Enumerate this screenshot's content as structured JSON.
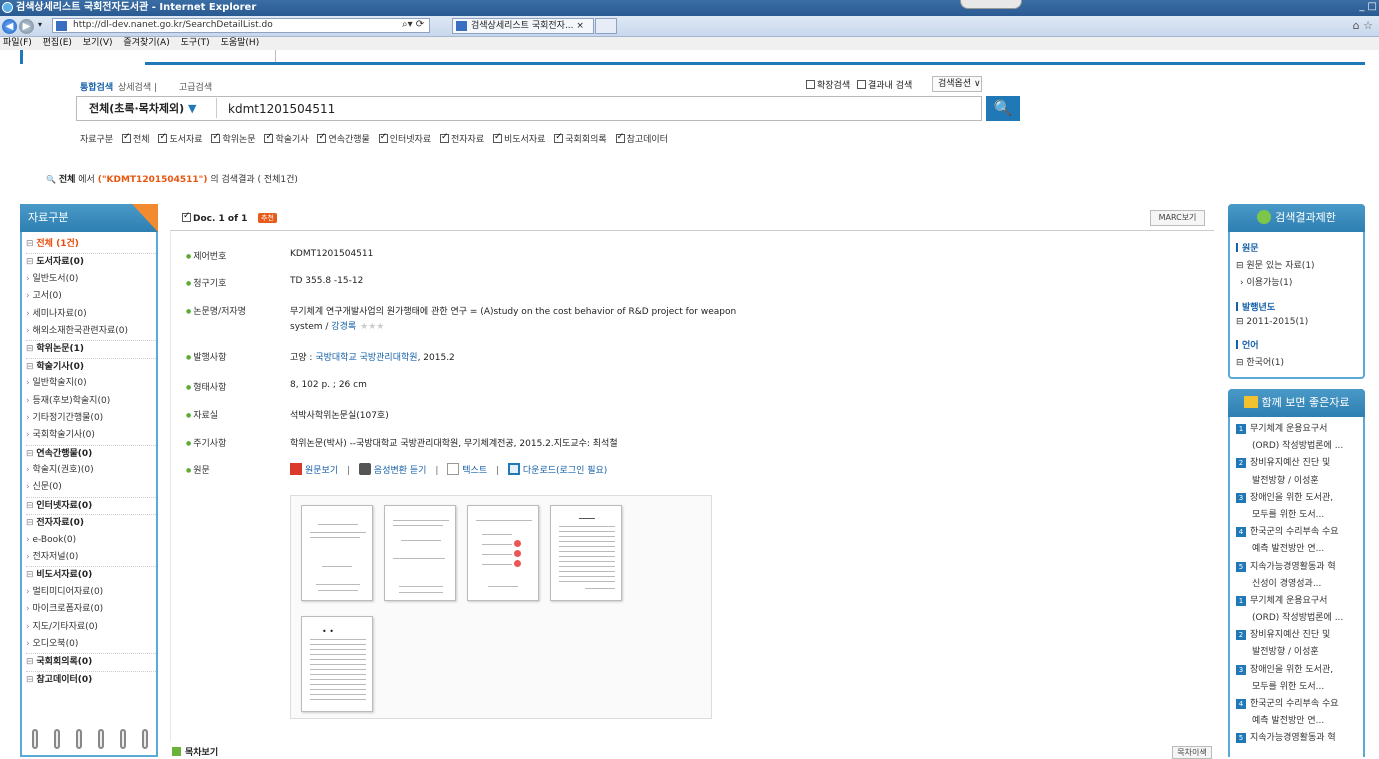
{
  "browser": {
    "title": "검색상세리스트 국회전자도서관 - Internet Explorer",
    "url": "http://dl-dev.nanet.go.kr/SearchDetailList.do",
    "tab_label": "검색상세리스트 국회전자... ×",
    "menu": [
      "파일(F)",
      "편집(E)",
      "보기(V)",
      "즐겨찾기(A)",
      "도구(T)",
      "도움말(H)"
    ],
    "window_controls": "_ □",
    "home_star": "⌂ ☆"
  },
  "search": {
    "tabs": [
      "통합검색",
      "상세검색 |",
      "고급검색"
    ],
    "scope": "전체(초록·목차제외)",
    "scope_arrow": "▼",
    "query": "kdmt1201504511",
    "button_icon": "search-icon",
    "button_glyph": "🔍",
    "options": [
      "확장검색",
      "결과내 검색"
    ],
    "options_select": "검색옵션 ∨",
    "type_label": "자료구분",
    "types": [
      "전체",
      "도서자료",
      "학위논문",
      "학술기사",
      "연속간행물",
      "인터넷자료",
      "전자자료",
      "비도서자료",
      "국회회의록",
      "참고데이터"
    ]
  },
  "result_summary": {
    "icon": "🔍",
    "scope": "전체",
    "in": "에서",
    "query": "(\"KDMT1201504511\")",
    "suffix": "의 검색결과 ( 전체1건)"
  },
  "left_panel": {
    "title": "자료구분",
    "items": [
      {
        "label": "전체 (1건)",
        "kind": "cat red"
      },
      {
        "label": "도서자료(0)",
        "kind": "cat"
      },
      {
        "label": "일반도서(0)",
        "kind": "sub"
      },
      {
        "label": "고서(0)",
        "kind": "sub"
      },
      {
        "label": "세미나자료(0)",
        "kind": "sub"
      },
      {
        "label": "해외소재한국관련자료(0)",
        "kind": "sub"
      },
      {
        "label": "학위논문(1)",
        "kind": "cat"
      },
      {
        "label": "학술기사(0)",
        "kind": "cat"
      },
      {
        "label": "일반학술지(0)",
        "kind": "sub"
      },
      {
        "label": "등재(후보)학술지(0)",
        "kind": "sub"
      },
      {
        "label": "기타정기간행물(0)",
        "kind": "sub"
      },
      {
        "label": "국회학술기사(0)",
        "kind": "sub"
      },
      {
        "label": "연속간행물(0)",
        "kind": "cat"
      },
      {
        "label": "학술지(권호)(0)",
        "kind": "sub"
      },
      {
        "label": "신문(0)",
        "kind": "sub"
      },
      {
        "label": "인터넷자료(0)",
        "kind": "cat"
      },
      {
        "label": "전자자료(0)",
        "kind": "cat"
      },
      {
        "label": "e-Book(0)",
        "kind": "sub"
      },
      {
        "label": "전자저널(0)",
        "kind": "sub"
      },
      {
        "label": "비도서자료(0)",
        "kind": "cat"
      },
      {
        "label": "멀티미디어자료(0)",
        "kind": "sub"
      },
      {
        "label": "마이크로폼자료(0)",
        "kind": "sub"
      },
      {
        "label": "지도/기타자료(0)",
        "kind": "sub"
      },
      {
        "label": "오디오북(0)",
        "kind": "sub"
      },
      {
        "label": "국회회의록(0)",
        "kind": "cat"
      },
      {
        "label": "참고데이터(0)",
        "kind": "cat"
      }
    ]
  },
  "doc": {
    "header": "Doc. 1 of 1",
    "badge": "추천",
    "marc_button": "MARC보기",
    "fields": [
      {
        "label": "제어번호",
        "value": "KDMT1201504511"
      },
      {
        "label": "청구기호",
        "value": "TD 355.8 -15-12"
      },
      {
        "label": "논문명/저자명",
        "value": "무기체계 연구개발사업의 원가행태에 관한 연구 = (A)study on the cost behavior of R&D project for weapon",
        "value2": "system / ",
        "author": "강경록"
      },
      {
        "label": "발행사항",
        "value": "고양 : ",
        "link": "국방대학교 국방관리대학원",
        "value_end": ", 2015.2"
      },
      {
        "label": "형태사항",
        "value": "8, 102 p. ; 26 cm"
      },
      {
        "label": "자료실",
        "value": "석박사학위논문실(107호)"
      },
      {
        "label": "주기사항",
        "value": "학위논문(박사) --국방대학교 국방관리대학원, 무기체계전공, 2015.2.지도교수: 최석철"
      },
      {
        "label": "원문",
        "value": ""
      }
    ],
    "stars": "★★★",
    "original_links": {
      "view": "원문보기",
      "sep": "|",
      "tts": "음성변환 듣기",
      "text": "텍스트",
      "download": "다운로드(로그인 필요)"
    },
    "toc_label": "목차보기",
    "toc_button": "목차이색"
  },
  "limit_panel": {
    "title": "검색결과제한",
    "groups": [
      {
        "heading": "원문",
        "items": [
          "⊟ 원문 있는 자료(1)",
          "› 이용가능(1)"
        ]
      },
      {
        "heading": "발행년도",
        "items": [
          "⊟ 2011-2015(1)"
        ]
      },
      {
        "heading": "언어",
        "items": [
          "⊟ 한국어(1)"
        ]
      }
    ]
  },
  "recommend_panel": {
    "title": "함께 보면 좋은자료",
    "items": [
      {
        "n": "1",
        "l1": "무기체계 운용요구서",
        "l2": "(ORD) 작성방법론에 ..."
      },
      {
        "n": "2",
        "l1": "장비유지예산 진단 및",
        "l2": "발전방향 / 이성훈"
      },
      {
        "n": "3",
        "l1": "장애인을 위한 도서관,",
        "l2": "모두를 위한 도서..."
      },
      {
        "n": "4",
        "l1": "한국군의 수리부속 수요",
        "l2": "예측 발전방안 연..."
      },
      {
        "n": "5",
        "l1": "지속가능경영활동과 혁",
        "l2": "신성이 경영성과..."
      },
      {
        "n": "1",
        "l1": "무기체계 운용요구서",
        "l2": "(ORD) 작성방법론에 ..."
      },
      {
        "n": "2",
        "l1": "장비유지예산 진단 및",
        "l2": "발전방향 / 이성훈"
      },
      {
        "n": "3",
        "l1": "장애인을 위한 도서관,",
        "l2": "모두를 위한 도서..."
      },
      {
        "n": "4",
        "l1": "한국군의 수리부속 수요",
        "l2": "예측 발전방안 연..."
      },
      {
        "n": "5",
        "l1": "지속가능경영활동과 혁",
        "l2": ""
      }
    ]
  },
  "colors": {
    "accent": "#2178b6",
    "orange": "#e8560f",
    "green": "#5aab32"
  }
}
